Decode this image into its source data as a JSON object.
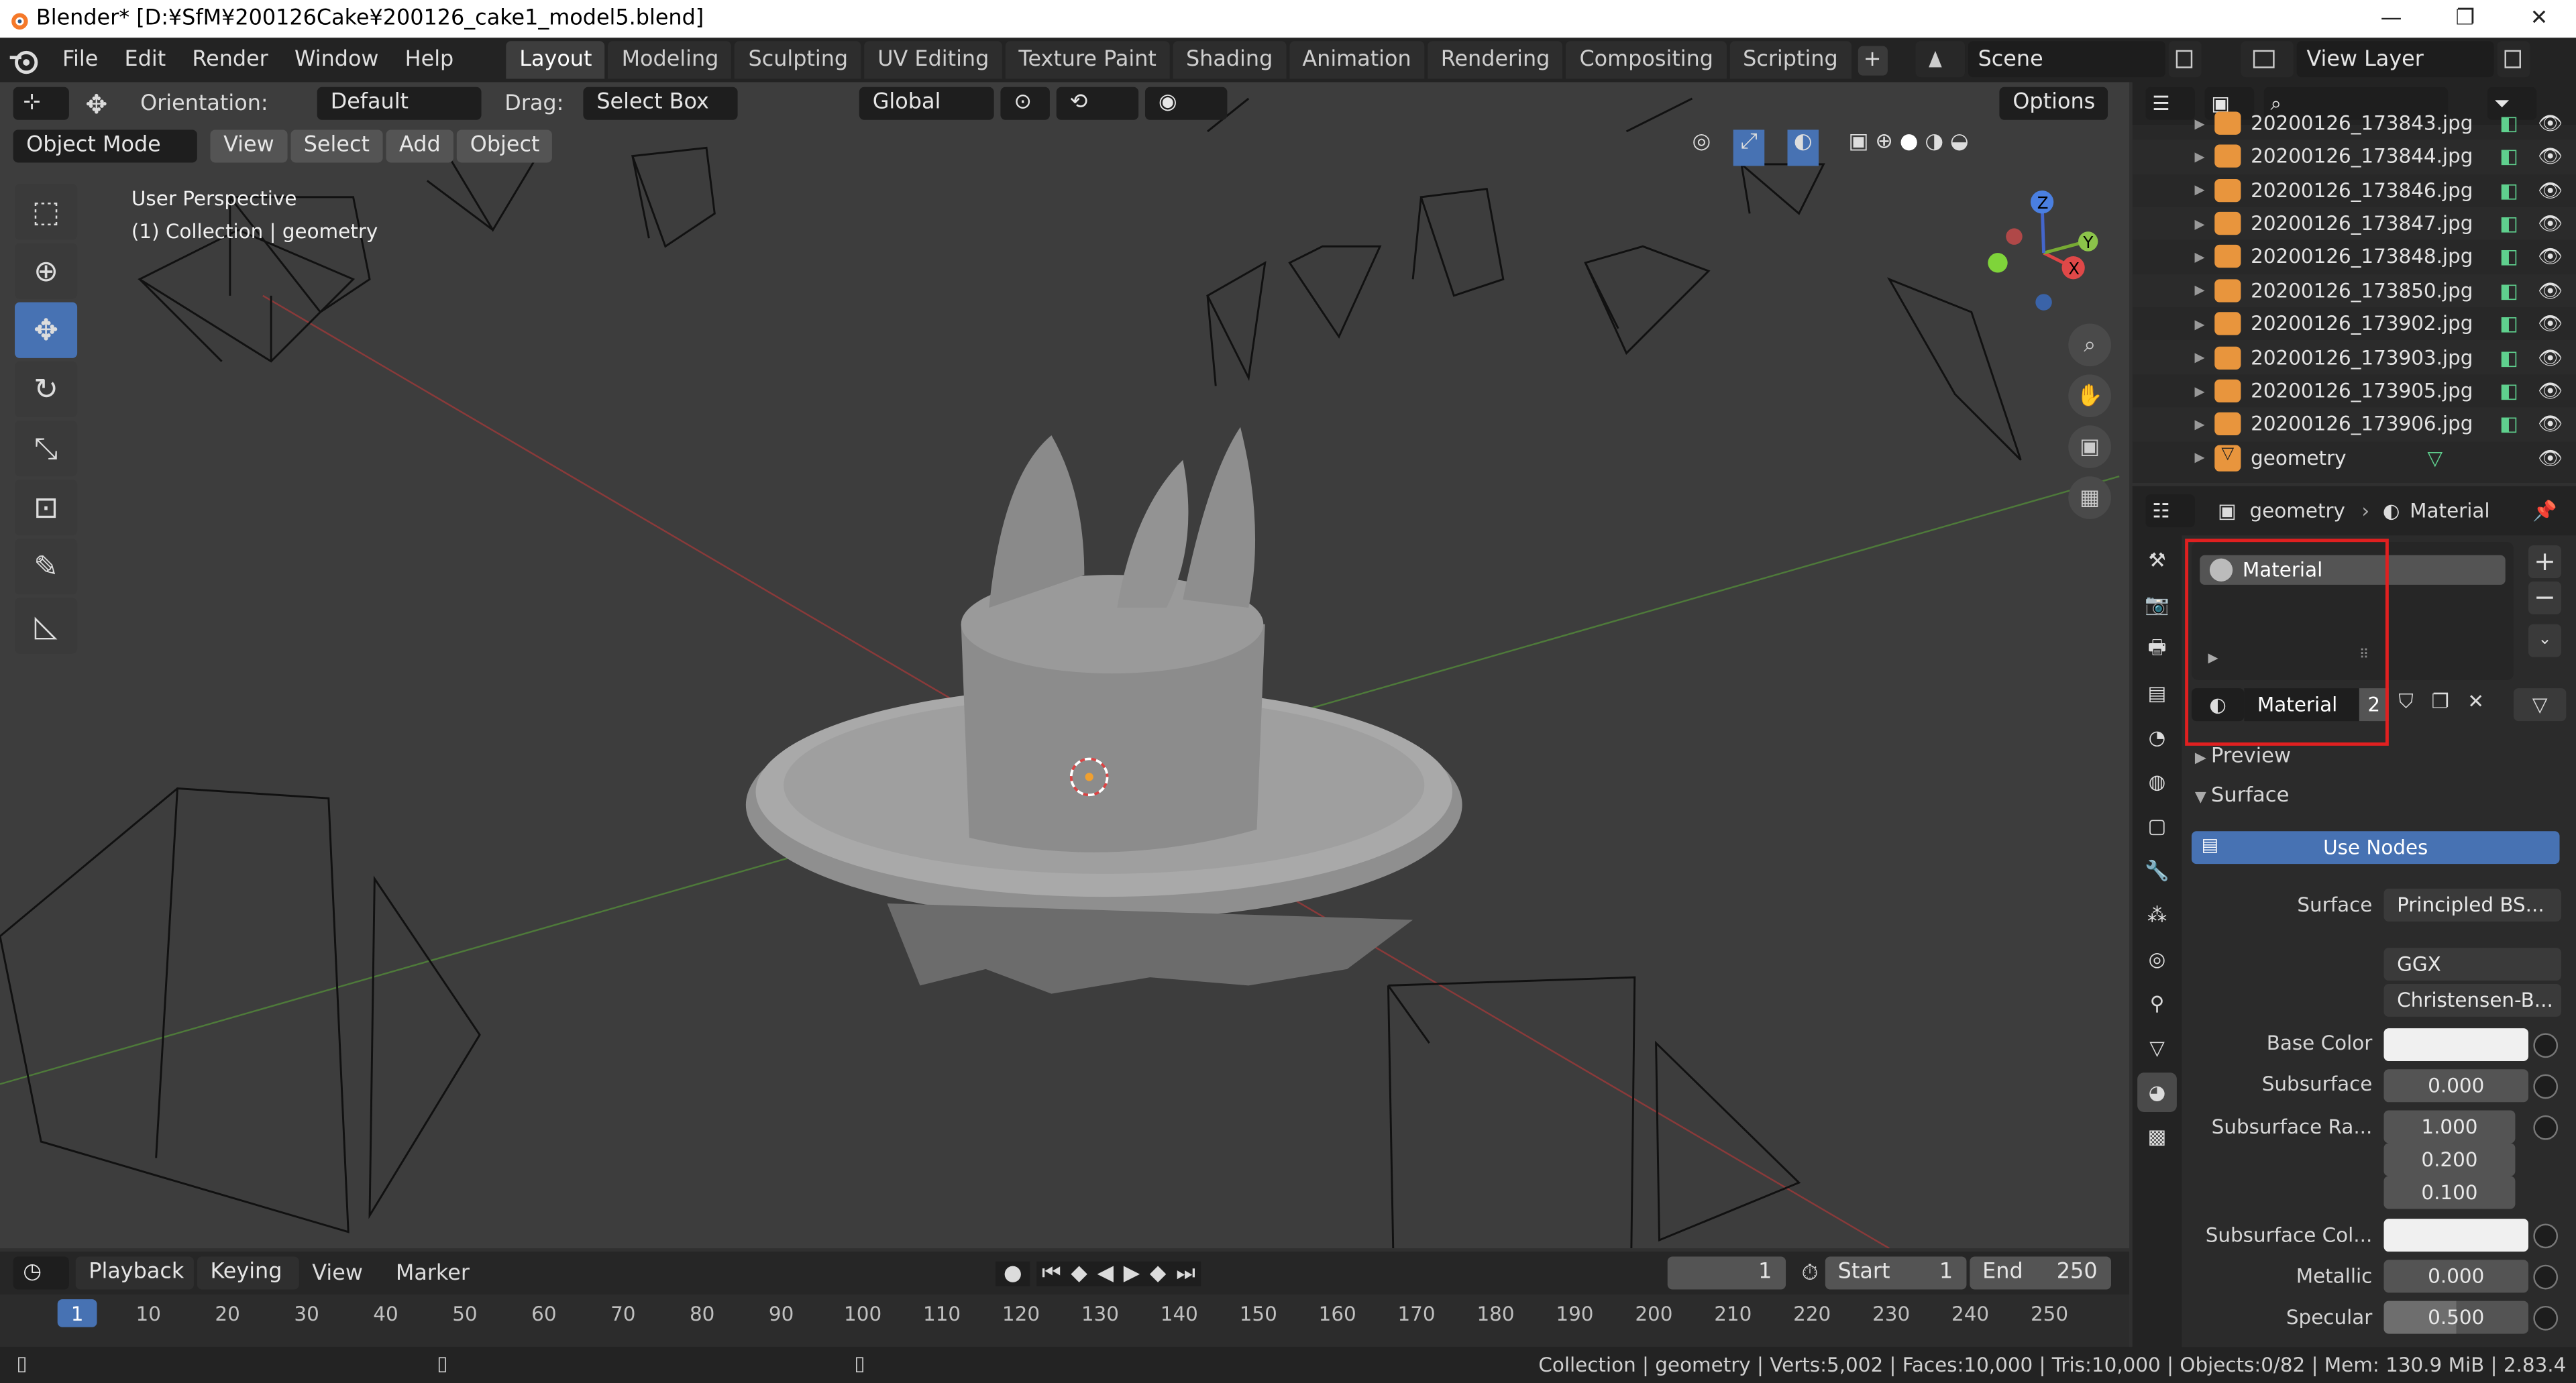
{
  "window": {
    "title": "Blender* [D:¥SfM¥200126Cake¥200126_cake1_model5.blend]",
    "minimize": "—",
    "maximize": "❐",
    "close": "✕"
  },
  "menu": [
    "File",
    "Edit",
    "Render",
    "Window",
    "Help"
  ],
  "workspaces": [
    "Layout",
    "Modeling",
    "Sculpting",
    "UV Editing",
    "Texture Paint",
    "Shading",
    "Animation",
    "Rendering",
    "Compositing",
    "Scripting"
  ],
  "workspace_add": "+",
  "scene": {
    "label": "Scene",
    "view_layer": "View Layer"
  },
  "viewport_header": {
    "orientation_label": "Orientation:",
    "orientation_value": "Default",
    "drag_label": "Drag:",
    "drag_value": "Select Box",
    "transform_space": "Global",
    "options": "Options",
    "mode": "Object Mode",
    "view": "View",
    "select": "Select",
    "add": "Add",
    "object": "Object"
  },
  "viewport": {
    "perspective": "User Perspective",
    "collection": "(1) Collection | geometry",
    "gizmo": {
      "x": "X",
      "y": "Y",
      "z": "Z"
    }
  },
  "outliner": {
    "partial": "20200126_173843.jpg",
    "items": [
      "20200126_173844.jpg",
      "20200126_173846.jpg",
      "20200126_173847.jpg",
      "20200126_173848.jpg",
      "20200126_173850.jpg",
      "20200126_173902.jpg",
      "20200126_173903.jpg",
      "20200126_173905.jpg",
      "20200126_173906.jpg"
    ],
    "geometry": "geometry"
  },
  "properties": {
    "breadcrumb_object": "geometry",
    "breadcrumb_material": "Material",
    "slot_name": "Material",
    "material_name": "Material",
    "users": "2",
    "preview": "Preview",
    "surface_section": "Surface",
    "use_nodes": "Use Nodes",
    "surface_label": "Surface",
    "surface_value": "Principled BS...",
    "distribution": "GGX",
    "subsurface_method": "Christensen-B...",
    "base_color_label": "Base Color",
    "subsurface_label": "Subsurface",
    "subsurface_value": "0.000",
    "subsurface_radius_label": "Subsurface Ra...",
    "subsurface_radius": [
      "1.000",
      "0.200",
      "0.100"
    ],
    "subsurface_color_label": "Subsurface Col...",
    "metallic_label": "Metallic",
    "metallic_value": "0.000",
    "specular_label": "Specular",
    "specular_value": "0.500"
  },
  "timeline": {
    "playback": "Playback",
    "keying": "Keying",
    "view": "View",
    "marker": "Marker",
    "current_frame": "1",
    "start_label": "Start",
    "start": "1",
    "end_label": "End",
    "end": "250",
    "ruler": [
      "1",
      "10",
      "20",
      "30",
      "40",
      "50",
      "60",
      "70",
      "80",
      "90",
      "100",
      "110",
      "120",
      "130",
      "140",
      "150",
      "160",
      "170",
      "180",
      "190",
      "200",
      "210",
      "220",
      "230",
      "240",
      "250"
    ]
  },
  "status": "Collection | geometry | Verts:5,002 | Faces:10,000 | Tris:10,000 | Objects:0/82 | Mem: 130.9 MiB | 2.83.4",
  "colors": {
    "accent": "#4772b3",
    "highlight": "#e02020",
    "camera_icon": "#e8953d"
  }
}
